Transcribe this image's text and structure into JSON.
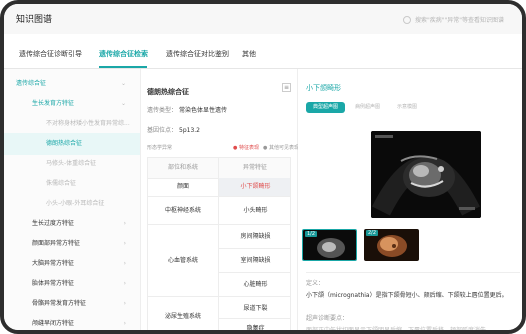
{
  "header": {
    "title": "知识图谱",
    "hint": "搜索\"疾病\"\"异常\"等查看知识图谱"
  },
  "tabs": [
    {
      "label": "遗传综合征诊断引导"
    },
    {
      "label": "遗传综合征检索"
    },
    {
      "label": "遗传综合征对比鉴别"
    },
    {
      "label": "其他"
    }
  ],
  "sidebar": {
    "items": [
      {
        "label": "遗传综合征",
        "chevron": "⌄"
      },
      {
        "label": "生长发育方特征",
        "chevron": "⌄"
      },
      {
        "label": "不对称身材矮小性发育异常综...",
        "chevron": ""
      },
      {
        "label": "德朗热综合征",
        "chevron": ""
      },
      {
        "label": "马修头-体重综合征",
        "chevron": ""
      },
      {
        "label": "侏儒综合征",
        "chevron": ""
      },
      {
        "label": "小头-小眼-外耳综合征",
        "chevron": ""
      },
      {
        "label": "生长过度方特征",
        "chevron": "›"
      },
      {
        "label": "颜面部异常方特征",
        "chevron": "›"
      },
      {
        "label": "大脑异常方特征",
        "chevron": "›"
      },
      {
        "label": "胎体异常方特征",
        "chevron": "›"
      },
      {
        "label": "骨骼异常发育方特征",
        "chevron": "›"
      },
      {
        "label": "颅缝早闭方特征",
        "chevron": "›"
      }
    ]
  },
  "detail": {
    "title": "德朗热综合征",
    "menu_icon": "≡",
    "inheritance_label": "遗传类型：",
    "inheritance_value": "常染色体显性遗传",
    "locus_label": "基因位点：",
    "locus_value": "5p13.2",
    "phenotype_label": "形态学异常",
    "legend_red": "● 特征表现",
    "legend_gray": "● 其他可见表现",
    "table": {
      "col1": "部位和系统",
      "col2": "异常特征",
      "rows": [
        {
          "system": "颜面",
          "feature": "小下颌畸形",
          "highlight": true
        },
        {
          "system": "中枢神经系统",
          "feature": "小头畸形",
          "highlight": false
        },
        {
          "system": "",
          "feature": "房间隔缺损",
          "highlight": false
        },
        {
          "system": "心血管系统",
          "feature": "室间隔缺损",
          "highlight": false
        },
        {
          "system": "",
          "feature": "心脏畸形",
          "highlight": false
        },
        {
          "system": "泌尿生殖系统",
          "feature": "尿道下裂",
          "highlight": false
        },
        {
          "system": "",
          "feature": "隐睾症",
          "highlight": false
        }
      ]
    }
  },
  "panel": {
    "title": "小下颌畸形",
    "pills": [
      "典型超声图",
      "病例超声图",
      "示意模图"
    ],
    "thumb_labels": [
      "1/2",
      "2/2"
    ],
    "def_label": "定义：",
    "def_text": "小下颌（micrognathia）是指下颌骨短小、颏后缩、下颌较上唇位置更后。",
    "features_label": "超声诊断要点：",
    "features_text": "面部正中矢状切面显示下颌明显后缩，下唇位置后移，颏部弧度消失…",
    "accent": "#1aa7a7"
  }
}
